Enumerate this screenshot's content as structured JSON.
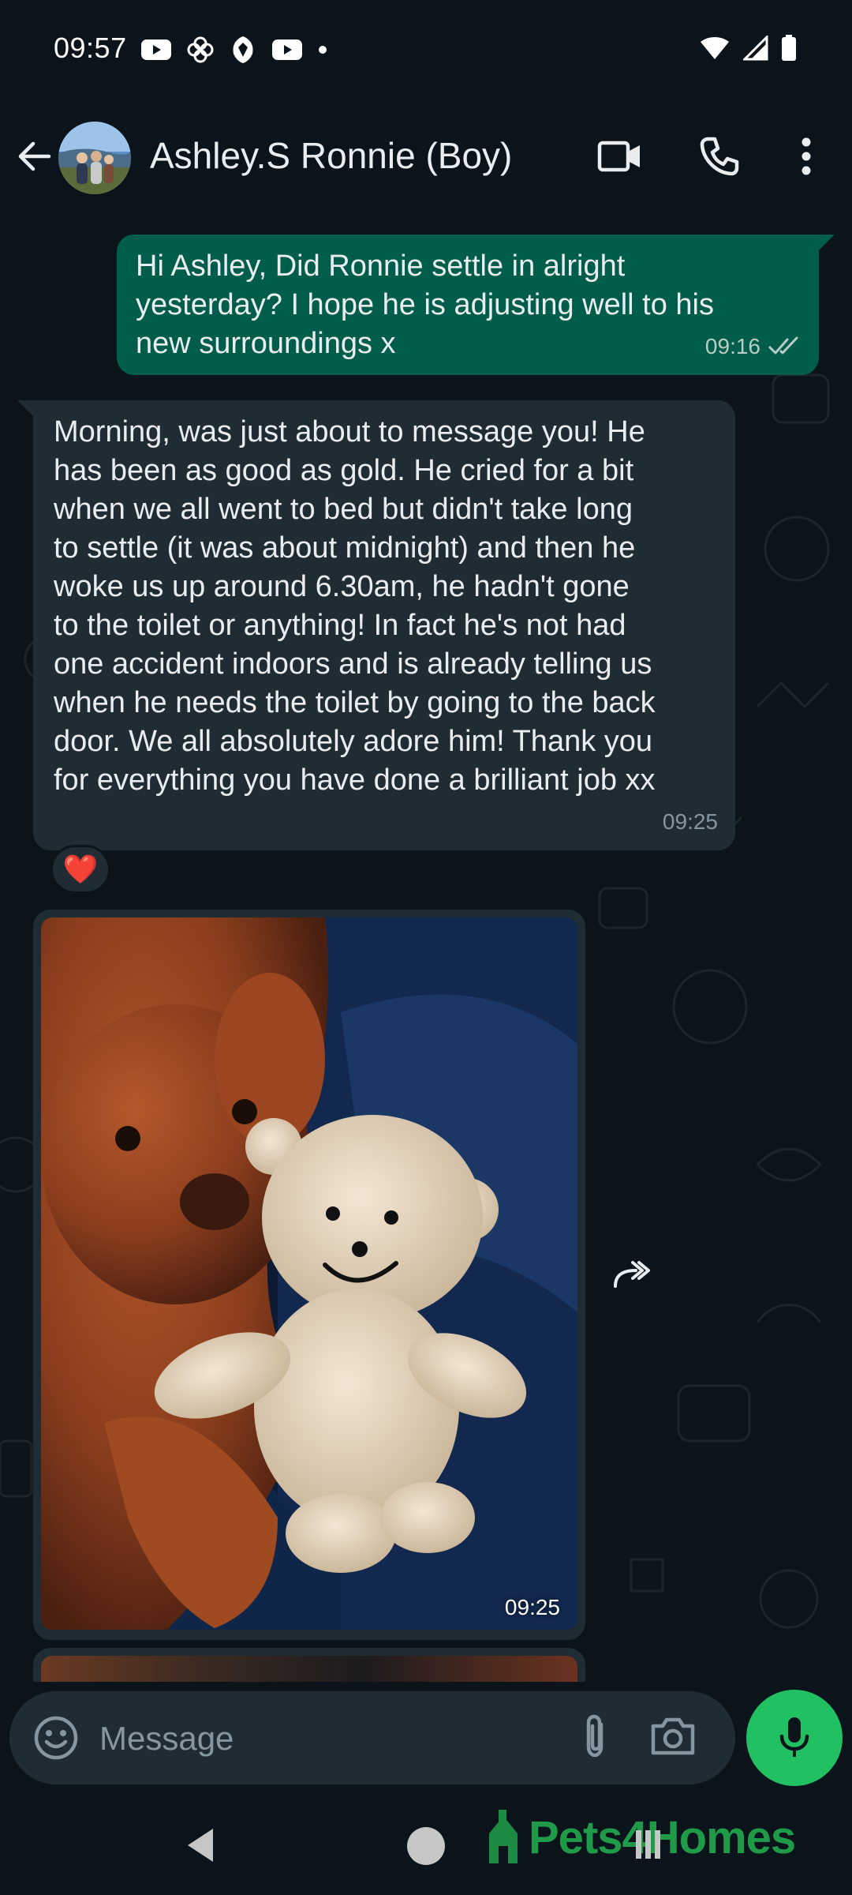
{
  "status_bar": {
    "time": "09:57"
  },
  "header": {
    "contact_name": "Ashley.S Ronnie (Boy)"
  },
  "messages": {
    "outgoing": {
      "text": "Hi Ashley, Did Ronnie settle in alright\nyesterday? I hope he is adjusting well to his\nnew surroundings x",
      "time": "09:16"
    },
    "incoming": {
      "text": "Morning, was just about to message you! He\nhas been as good as gold. He cried for a bit\nwhen we all went to bed but didn't take long\nto settle (it was about midnight) and then he\nwoke us up around 6.30am, he hadn't gone\nto the toilet or anything! In fact he's not had\none accident indoors and is already telling us\nwhen he needs the toilet by going to the back\ndoor. We all absolutely adore him! Thank you\nfor everything you have done a brilliant job xx",
      "time": "09:25",
      "reaction": "❤️"
    },
    "image": {
      "time": "09:25"
    }
  },
  "composer": {
    "placeholder": "Message"
  },
  "watermark": {
    "brand": "Pets4Homes"
  },
  "colors": {
    "background": "#0b141a",
    "outgoing_bubble": "#005c4b",
    "incoming_bubble": "#202c33",
    "accent_green": "#21c063"
  }
}
